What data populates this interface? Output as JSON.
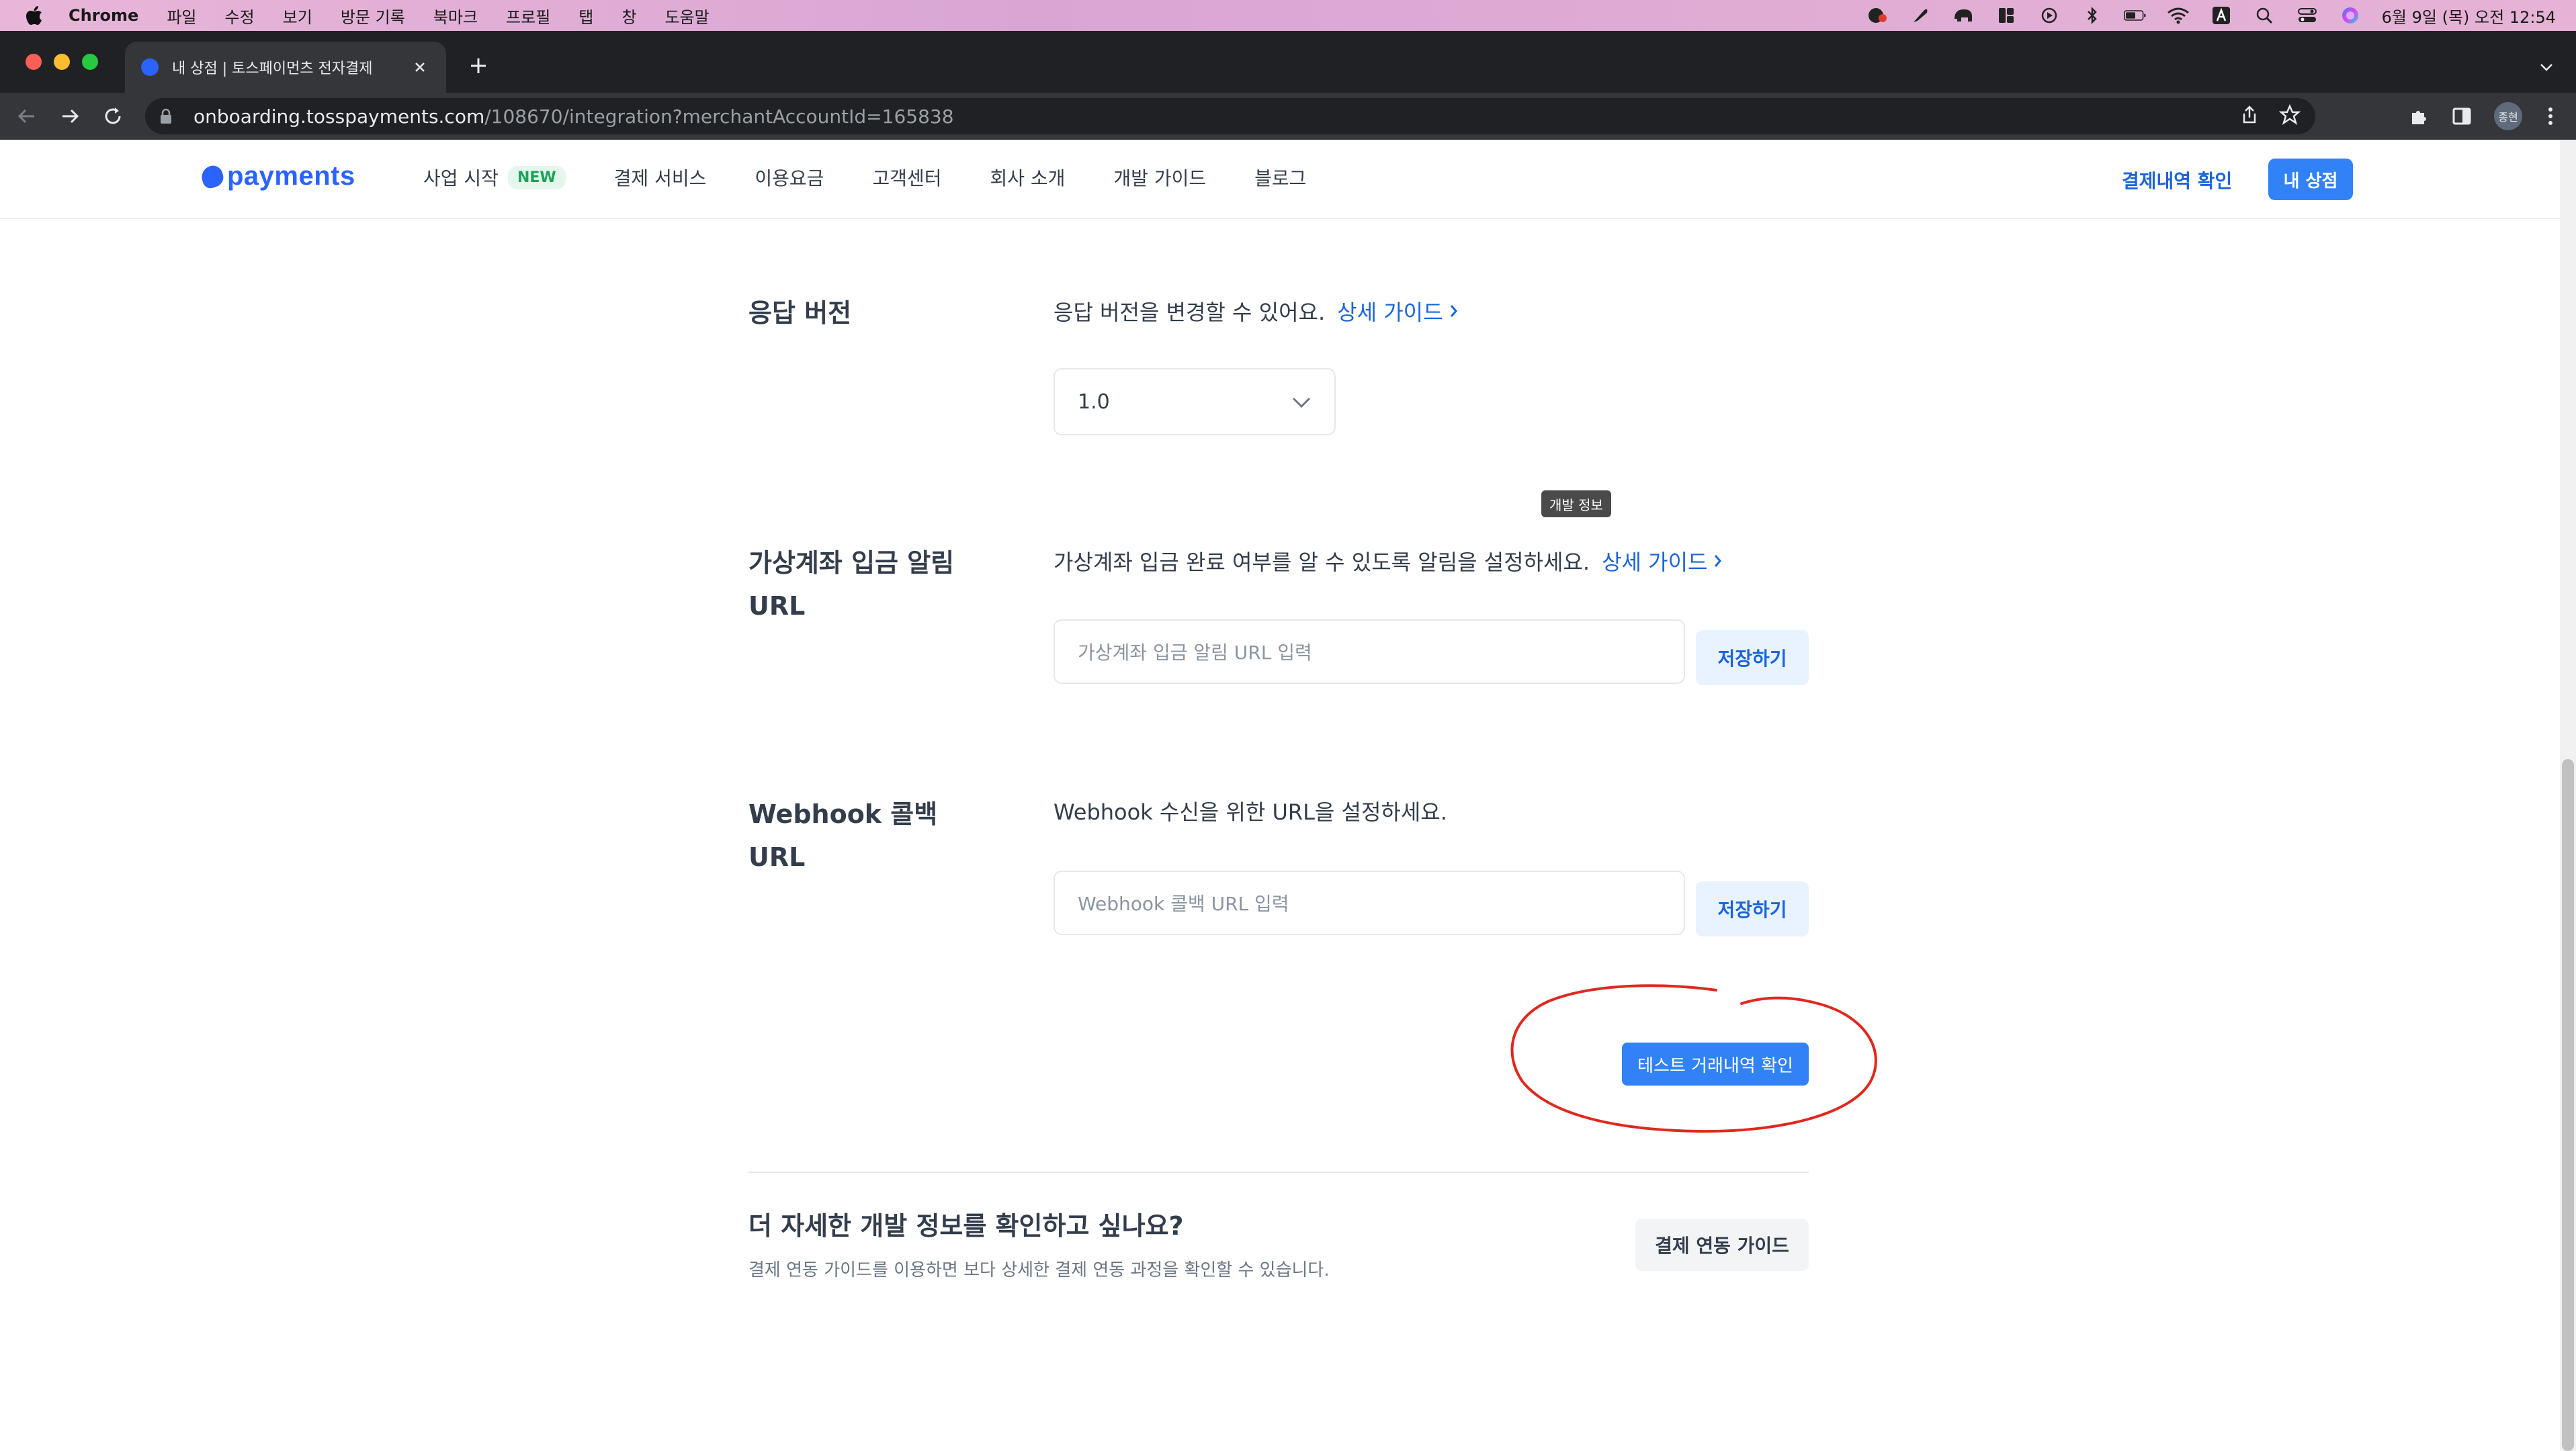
{
  "menubar": {
    "app_name": "Chrome",
    "items": [
      "파일",
      "수정",
      "보기",
      "방문 기록",
      "북마크",
      "프로필",
      "탭",
      "창",
      "도움말"
    ],
    "clock": "6월 9일 (목) 오전 12:54"
  },
  "browser": {
    "tab_title": "내 상점 | 토스페이먼츠 전자결제",
    "url_host": "onboarding.tosspayments.com",
    "url_path": "/108670/integration?merchantAccountId=165838",
    "avatar_text": "종현"
  },
  "site": {
    "logo_text": "payments",
    "nav": [
      {
        "label": "사업 시작",
        "badge": "NEW"
      },
      {
        "label": "결제 서비스"
      },
      {
        "label": "이용요금"
      },
      {
        "label": "고객센터"
      },
      {
        "label": "회사 소개"
      },
      {
        "label": "개발 가이드"
      },
      {
        "label": "블로그"
      }
    ],
    "header_link": "결제내역 확인",
    "header_button": "내 상점"
  },
  "sections": {
    "response_version": {
      "title": "응답 버전",
      "description": "응답 버전을 변경할 수 있어요.",
      "guide_link": "상세 가이드",
      "selected_value": "1.0"
    },
    "tooltip": "개발 정보",
    "virtual_account": {
      "title": "가상계좌 입금 알림\nURL",
      "description": "가상계좌 입금 완료 여부를 알 수 있도록 알림을 설정하세요.",
      "guide_link": "상세 가이드",
      "placeholder": "가상계좌 입금 알림 URL 입력",
      "save_label": "저장하기"
    },
    "webhook": {
      "title": "Webhook 콜백\nURL",
      "description": "Webhook 수신을 위한 URL을 설정하세요.",
      "placeholder": "Webhook 콜백 URL 입력",
      "save_label": "저장하기"
    },
    "test_button": "테스트 거래내역 확인"
  },
  "footer": {
    "title": "더 자세한 개발 정보를 확인하고 싶나요?",
    "description": "결제 연동 가이드를 이용하면 보다 상세한 결제 연동 과정을 확인할 수 있습니다.",
    "button": "결제 연동 가이드"
  },
  "colors": {
    "brand_blue": "#3182f6",
    "link_blue": "#1b64da",
    "annotation_red": "#e0281f"
  }
}
